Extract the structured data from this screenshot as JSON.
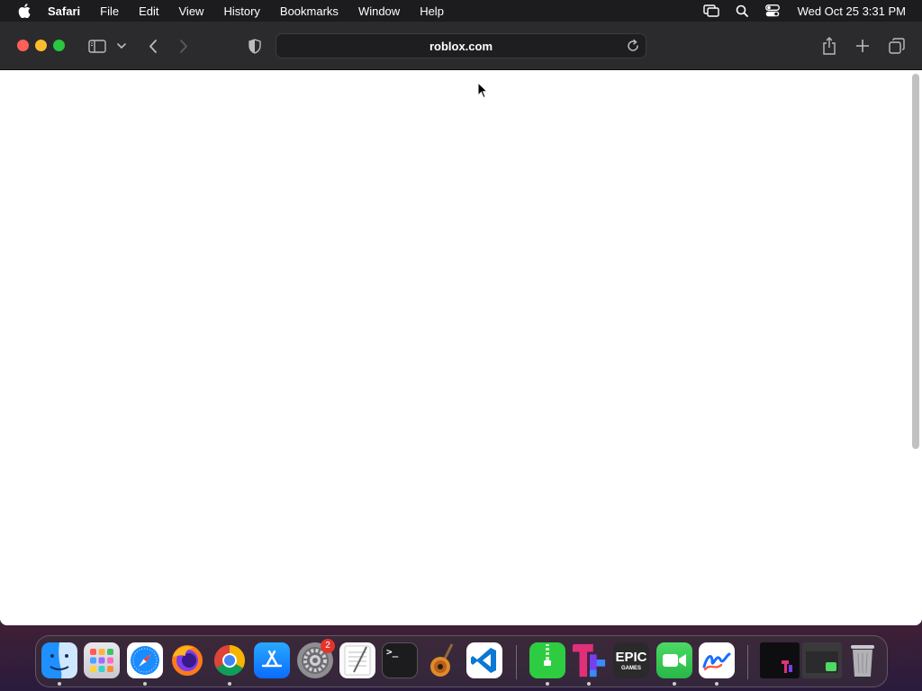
{
  "menubar": {
    "app_name": "Safari",
    "items": [
      "File",
      "Edit",
      "View",
      "History",
      "Bookmarks",
      "Window",
      "Help"
    ],
    "clock": "Wed Oct 25  3:31 PM"
  },
  "browser": {
    "url": "roblox.com"
  },
  "dock": {
    "apps": [
      {
        "name": "Finder",
        "icon": "finder-icon",
        "running": true
      },
      {
        "name": "Launchpad",
        "icon": "launchpad-icon",
        "running": false
      },
      {
        "name": "Safari",
        "icon": "safari-icon",
        "running": true
      },
      {
        "name": "Firefox",
        "icon": "firefox-icon",
        "running": false
      },
      {
        "name": "Chrome",
        "icon": "chrome-icon",
        "running": true
      },
      {
        "name": "App Store",
        "icon": "app-store-icon",
        "running": false
      },
      {
        "name": "System Settings",
        "icon": "settings-icon",
        "running": false
      },
      {
        "name": "TextEdit",
        "icon": "textedit-icon",
        "running": false
      },
      {
        "name": "Terminal",
        "icon": "terminal-icon",
        "running": false
      },
      {
        "name": "GarageBand",
        "icon": "garageband-icon",
        "running": false
      },
      {
        "name": "VS Code",
        "icon": "vscode-icon",
        "running": false
      },
      {
        "name": "Archive Utility",
        "icon": "archive-icon",
        "running": true
      },
      {
        "name": "Tetris",
        "icon": "tetris-icon",
        "running": true
      },
      {
        "name": "Epic Games",
        "icon": "epic-games-icon",
        "running": false
      },
      {
        "name": "FaceTime",
        "icon": "facetime-icon",
        "running": true
      },
      {
        "name": "Freeform",
        "icon": "freeform-icon",
        "running": true
      }
    ],
    "settings_badge": "2",
    "epic_label_top": "EPIC",
    "epic_label_bottom": "GAMES",
    "terminal_prompt": ">_"
  }
}
